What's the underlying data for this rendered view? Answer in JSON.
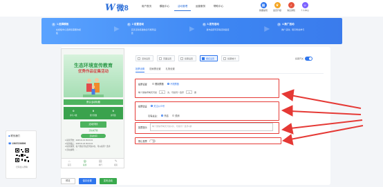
{
  "colors": {
    "accent": "#2f76ed",
    "green": "#3aa24d",
    "annotation": "#e53935"
  },
  "nav": {
    "logo_mark": "W",
    "logo_text": "微8",
    "links": [
      "用户首页",
      "模板中心",
      "活动管理",
      "运营服务",
      "帮助中心"
    ],
    "active_index": 2,
    "icons": [
      {
        "icon": "grid-icon",
        "label": "我要提现",
        "color": "#2f76ed"
      },
      {
        "icon": "crown-icon",
        "label": "会员升级",
        "color": "#f5a623"
      },
      {
        "icon": "bell-icon",
        "label": "消息通知",
        "color": "#e5533d"
      },
      {
        "icon": "user-icon",
        "label": "个人中心",
        "color": "#7b61ff"
      }
    ]
  },
  "steps": [
    {
      "num": "1",
      "title": "1.选择模板",
      "desc": "在模板中心选择您需要的模板"
    },
    {
      "num": "2",
      "title": "2.设置活动",
      "desc": "完善活动基础信息与规则设置"
    },
    {
      "num": "3",
      "title": "3.发布活动",
      "desc": "发布后即可获得活动链接"
    },
    {
      "num": "4",
      "title": "4.推广活动",
      "desc": "推广活动，吸引粉丝参与"
    }
  ],
  "preview": {
    "poster_title": "生态环境宣传教育",
    "poster_subtitle": "优秀作品征集活动",
    "green_bar": "默认活动标题",
    "stats": [
      {
        "value": "0",
        "label": "参与人数"
      },
      {
        "value": "0",
        "label": "累计票数"
      },
      {
        "value": "0",
        "label": "访问量"
      }
    ],
    "button": "活动详情",
    "hint": "活动未开始",
    "pill": "活动时间",
    "info_lines": [
      "1.投票开始：2025.01.10 09:43:21",
      "2.投票截止：2025.01.20 09:43:21",
      "3.投票规则：每个微信号每天可投3次，可以投同一选手",
      "4.活动说明：..."
    ],
    "tabbar": [
      {
        "icon": "⌂",
        "name": "home-icon",
        "label": "首页"
      },
      {
        "icon": "◎",
        "name": "vote-icon",
        "label": "投票"
      },
      {
        "icon": "▤",
        "name": "rank-icon",
        "label": "排行"
      },
      {
        "icon": "✎",
        "name": "signup-icon",
        "label": "报名"
      }
    ]
  },
  "actions": {
    "preview": "预览",
    "save": "保存设置",
    "publish": "发布活动"
  },
  "settings": {
    "tabs": [
      "活动设置",
      "页面设置",
      "投票设置",
      "报名设置",
      "投票统计"
    ],
    "active_tab": 3,
    "switch_label": "投票开关",
    "subtabs": [
      "投票设置",
      "防刷票设置",
      "礼物设置"
    ],
    "active_subtab": 0,
    "limit_label": "投票设置",
    "limit_options": [
      "限制票数",
      "不限票数"
    ],
    "limit_row": {
      "prefix": "每个微信号每天可投",
      "value": "3",
      "unit": "次，可投同一选手",
      "value2": "1",
      "unit2": "票"
    },
    "verify_label": "投票验证",
    "verify_option": "关注公众号",
    "verify_sub_label": "引导关注：",
    "verify_sub_options": [
      "开启",
      "关闭"
    ],
    "msg_label": "投票提示",
    "msg_placeholder": "每个微信号每天可投3次，可投同一选手1票",
    "restrict_label": "禁止投票"
  },
  "left_widget": {
    "title": "联系我们",
    "phone": "13637236896",
    "caption": "扫码加入群聊"
  }
}
